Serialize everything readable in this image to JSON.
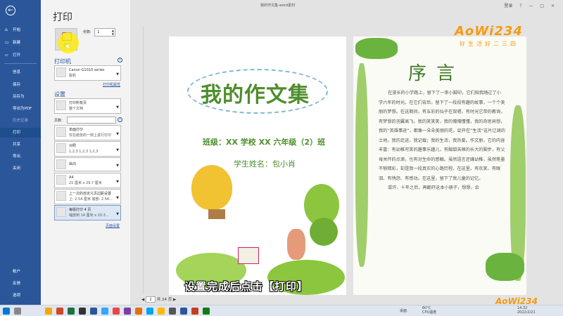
{
  "window": {
    "doc_title": "我的作文集-word素材",
    "account": "登录",
    "controls": [
      "?",
      "—",
      "□",
      "×"
    ]
  },
  "sidebar": {
    "items": [
      {
        "label": "开始",
        "icon": "home-icon"
      },
      {
        "label": "新建",
        "icon": "new-doc-icon"
      },
      {
        "label": "打开",
        "icon": "folder-icon"
      },
      {
        "label": "信息",
        "icon": ""
      },
      {
        "label": "保存",
        "icon": ""
      },
      {
        "label": "另存为",
        "icon": ""
      },
      {
        "label": "导出为PDF",
        "icon": ""
      },
      {
        "label": "历史记录",
        "icon": ""
      },
      {
        "label": "打印",
        "icon": ""
      },
      {
        "label": "共享",
        "icon": ""
      },
      {
        "label": "导出",
        "icon": ""
      },
      {
        "label": "关闭",
        "icon": ""
      },
      {
        "label": "帐户",
        "icon": ""
      },
      {
        "label": "反馈",
        "icon": ""
      },
      {
        "label": "选项",
        "icon": ""
      }
    ],
    "active": "打印"
  },
  "print": {
    "title": "打印",
    "button_label": "打印",
    "copies_label": "份数:",
    "copies_value": "1"
  },
  "printer": {
    "section": "打印机",
    "name": "Canon G1010 series",
    "status": "脱机",
    "properties_link": "打印机属性"
  },
  "settings": {
    "section": "设置",
    "range": {
      "t1": "打印所有页",
      "t2": "整个文档"
    },
    "pages_label": "页数:",
    "sides": {
      "t1": "单面打印",
      "t2": "仅在纸张的一侧上进行打印"
    },
    "collate": {
      "t1": "对照",
      "t2": "1,2,3    1,2,3    1,2,3"
    },
    "orientation": {
      "t1": "纵向",
      "t2": ""
    },
    "paper": {
      "t1": "A4",
      "t2": "21 厘米 x 29.7 厘米"
    },
    "margins": {
      "t1": "上一次的自定义页边距设置",
      "t2": "上: 2.54 厘米 底部: 2.54..."
    },
    "per_sheet": {
      "t1": "每版打印 4 页",
      "t2": "缩放到 14 厘米 x 20.3..."
    },
    "page_setup_link": "页面设置"
  },
  "preview": {
    "cover_title": "我的作文集",
    "cover_class": "班级：XX 学校 XX 六年级（2）班",
    "cover_name": "学生姓名：包小肖",
    "preface_title": "序言",
    "preface_text": "在漫长的小学路上，留下了一串小脚印，它们陪我踏过了小学六年的时光。在它们背后，留下了一段段有趣的故事，一个个美丽的梦想。在这期间，有五彩的仙子在双唱，有时光它带的教诲，有梦想的羽翼高飞。我的笑笑笑，我的懵懵懂懂，我的奇思异想，我的“英雄事迹”，都像一朵朵美丽的花，绽开在“生活”这片辽阔的土地。我的足迹，我记载；我的生活，我热爱。作文册，它的内容丰富：有幼稚可笑的趣事乐趣儿，有酸甜苦辣的长大的脚步，有父母关怀的点滴，也有对生命的感触。虽然语言还嫌幼稚，虽然笔墨不够精彩，却是我一段真实的心路历程，在这里，有欢笑、有眼泪、有悄怨、有感动。在这里，留下了我儿童的记忆。",
    "preface_text2": "或许，十年之后，再翻开这本小册子，想想，会",
    "watermark": "AoWi234",
    "watermark_sub": "好生活好二三四",
    "subtitle": "设置完成后点击【打印】"
  },
  "pager": {
    "current": "2",
    "total_text": "共 24 页"
  },
  "taskbar": {
    "weather": "60°C",
    "cpu": "CPU温度",
    "desktop": "桌面",
    "time": "14:32",
    "date": "2022/2/21"
  }
}
